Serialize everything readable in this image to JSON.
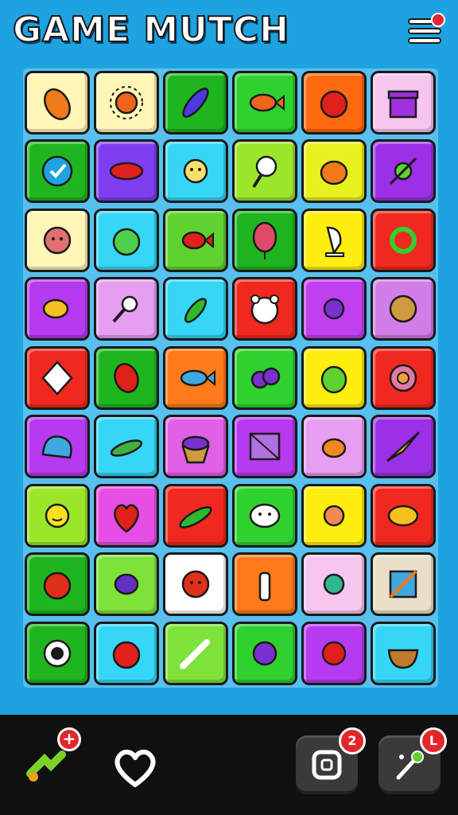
{
  "header": {
    "title": "GAME MUTCH",
    "menu_icon": "hamburger-menu-icon"
  },
  "colors": {
    "background": "#1ea3e0",
    "footer": "#101010",
    "badge": "#e3262b"
  },
  "board": {
    "columns": 6,
    "rows": 9,
    "tiles": [
      [
        {
          "icon": "carrot",
          "bg": "#fff6b8"
        },
        {
          "icon": "sun",
          "bg": "#fff6b8"
        },
        {
          "icon": "eggplant",
          "bg": "#1fb51f"
        },
        {
          "icon": "fish",
          "bg": "#2fd12f"
        },
        {
          "icon": "tomato",
          "bg": "#ff6a10"
        },
        {
          "icon": "gift-box",
          "bg": "#f6c6ef"
        }
      ],
      [
        {
          "icon": "check-ball",
          "bg": "#1fb51f"
        },
        {
          "icon": "lips",
          "bg": "#7f3df2"
        },
        {
          "icon": "sun-face",
          "bg": "#36d6f6"
        },
        {
          "icon": "racket",
          "bg": "#9be52a"
        },
        {
          "icon": "orange-fruit",
          "bg": "#e8f01e"
        },
        {
          "icon": "toy-arrow",
          "bg": "#9b30e6"
        }
      ],
      [
        {
          "icon": "face",
          "bg": "#fff6b8"
        },
        {
          "icon": "apple-green",
          "bg": "#36d6f6"
        },
        {
          "icon": "red-fish",
          "bg": "#5fd22f"
        },
        {
          "icon": "balloon",
          "bg": "#1fb51f"
        },
        {
          "icon": "lamp",
          "bg": "#ffee10"
        },
        {
          "icon": "knot",
          "bg": "#f0281f"
        }
      ],
      [
        {
          "icon": "yellow-fish",
          "bg": "#b63af0"
        },
        {
          "icon": "skull-key",
          "bg": "#e69ef0"
        },
        {
          "icon": "pepper-green",
          "bg": "#36d6f6"
        },
        {
          "icon": "bear-face",
          "bg": "#f0281f"
        },
        {
          "icon": "flower-purple",
          "bg": "#c040f0"
        },
        {
          "icon": "yarn-ball",
          "bg": "#d27ee8"
        }
      ],
      [
        {
          "icon": "kite",
          "bg": "#f0281f"
        },
        {
          "icon": "red-pepper",
          "bg": "#1fb51f"
        },
        {
          "icon": "blue-fish",
          "bg": "#ff7a1a"
        },
        {
          "icon": "grapes",
          "bg": "#2fd12f"
        },
        {
          "icon": "lime",
          "bg": "#ffee10"
        },
        {
          "icon": "rose",
          "bg": "#f0281f"
        }
      ],
      [
        {
          "icon": "blue-blob",
          "bg": "#b63af0"
        },
        {
          "icon": "cucumber",
          "bg": "#36d6f6"
        },
        {
          "icon": "cupcake",
          "bg": "#e060e6"
        },
        {
          "icon": "crate",
          "bg": "#b63af0"
        },
        {
          "icon": "bird",
          "bg": "#e69ef0"
        },
        {
          "icon": "paper-plane",
          "bg": "#9b30e6"
        }
      ],
      [
        {
          "icon": "sun-smile",
          "bg": "#9be52a"
        },
        {
          "icon": "heart-apple",
          "bg": "#e64ee6"
        },
        {
          "icon": "chili-green",
          "bg": "#f0281f"
        },
        {
          "icon": "smiley",
          "bg": "#2fd12f"
        },
        {
          "icon": "flower-face",
          "bg": "#ffee10"
        },
        {
          "icon": "yellow-blob",
          "bg": "#f0281f"
        }
      ],
      [
        {
          "icon": "strawberry",
          "bg": "#1fb51f"
        },
        {
          "icon": "purple-bird",
          "bg": "#7fe23a"
        },
        {
          "icon": "red-face",
          "bg": "#ffffff"
        },
        {
          "icon": "bottle",
          "bg": "#ff7a1a"
        },
        {
          "icon": "leaf-swirl",
          "bg": "#f6c6ef"
        },
        {
          "icon": "pencil-box",
          "bg": "#e9dfc8"
        }
      ],
      [
        {
          "icon": "eye-ring",
          "bg": "#1fb51f"
        },
        {
          "icon": "apple-red",
          "bg": "#36d6f6"
        },
        {
          "icon": "pencil",
          "bg": "#7fe23a"
        },
        {
          "icon": "purple-flower",
          "bg": "#2fd12f"
        },
        {
          "icon": "red-planet",
          "bg": "#b63af0"
        },
        {
          "icon": "bowl",
          "bg": "#36d6f6"
        }
      ]
    ]
  },
  "footer": {
    "hint_badge": "+",
    "shuffle_badge": "2",
    "wand_badge": "L"
  }
}
